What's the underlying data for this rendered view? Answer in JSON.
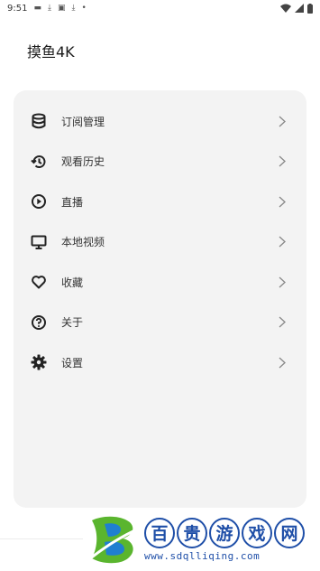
{
  "status_bar": {
    "time": "9:51",
    "notification_icons": [
      "media-icon",
      "download-icon",
      "image-icon",
      "download-icon",
      "dot-icon"
    ],
    "system_icons": [
      "wifi-icon",
      "signal-icon",
      "battery-icon"
    ]
  },
  "app": {
    "title": "摸鱼4K"
  },
  "menu": {
    "items": [
      {
        "label": "订阅管理",
        "icon": "database-icon"
      },
      {
        "label": "观看历史",
        "icon": "history-icon"
      },
      {
        "label": "直播",
        "icon": "play-circle-icon"
      },
      {
        "label": "本地视频",
        "icon": "monitor-icon"
      },
      {
        "label": "收藏",
        "icon": "heart-icon"
      },
      {
        "label": "关于",
        "icon": "help-icon"
      },
      {
        "label": "设置",
        "icon": "gear-icon"
      }
    ]
  },
  "watermark": {
    "chars": [
      "百",
      "贵",
      "游",
      "戏",
      "网"
    ],
    "url": "www.sdqlliqing.com"
  },
  "colors": {
    "card_bg": "#f3f3f3",
    "watermark_blue": "#1f4fa8",
    "watermark_green": "#5ab52e"
  }
}
